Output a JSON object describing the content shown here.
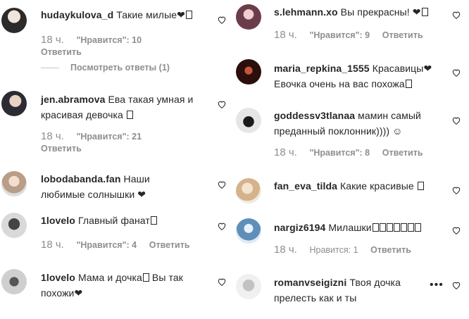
{
  "left": [
    {
      "user": "hudaykulova_d",
      "text": "Такие милые❤",
      "box": true,
      "time": "18 ч.",
      "likes": "\"Нравится\": 10",
      "reply": "Ответить",
      "view_replies": "Посмотреть ответы (1)"
    },
    {
      "user": "jen.abramova",
      "text": "Ева такая умная и",
      "text2": "красивая девочка",
      "box2": true,
      "time": "18 ч.",
      "likes": "\"Нравится\": 21",
      "reply": "Ответить"
    },
    {
      "user": "lobodabanda.fan",
      "text": "Наши",
      "text2": "любимые солнышки ❤"
    },
    {
      "user": "1lovelo",
      "text": "Главный фанат",
      "box": true,
      "time": "18 ч.",
      "likes": "\"Нравится\": 4",
      "reply": "Ответить"
    },
    {
      "user": "1lovelo",
      "text": "Мама и дочка",
      "box": true,
      "text_after": " Вы так",
      "text2": "похожи❤"
    }
  ],
  "right": [
    {
      "user": "s.lehmann.xo",
      "text": "Вы прекрасны! ❤",
      "box": true,
      "time": "18 ч.",
      "likes": "\"Нравится\": 9",
      "reply": "Ответить"
    },
    {
      "user": "maria_repkina_1555",
      "text": "Красавицы❤",
      "text2": "Евочка очень на вас похожа",
      "box2": true
    },
    {
      "user": "goddessv3tlanaa",
      "text": "мамин самый",
      "text2": "преданный поклонник)))) ☺",
      "time": "18 ч.",
      "likes": "\"Нравится\": 8",
      "reply": "Ответить"
    },
    {
      "user": "fan_eva_tilda",
      "text": "Какие красивые",
      "box": true
    },
    {
      "user": "nargiz6194",
      "text": "Милашки",
      "boxes": 7,
      "time": "18 ч.",
      "likes": "Нравится: 1",
      "reply": "Ответить"
    },
    {
      "user": "romanvseigizni",
      "text": "Твоя дочка",
      "text2": "прелесть как и ты",
      "more": "•••"
    }
  ]
}
